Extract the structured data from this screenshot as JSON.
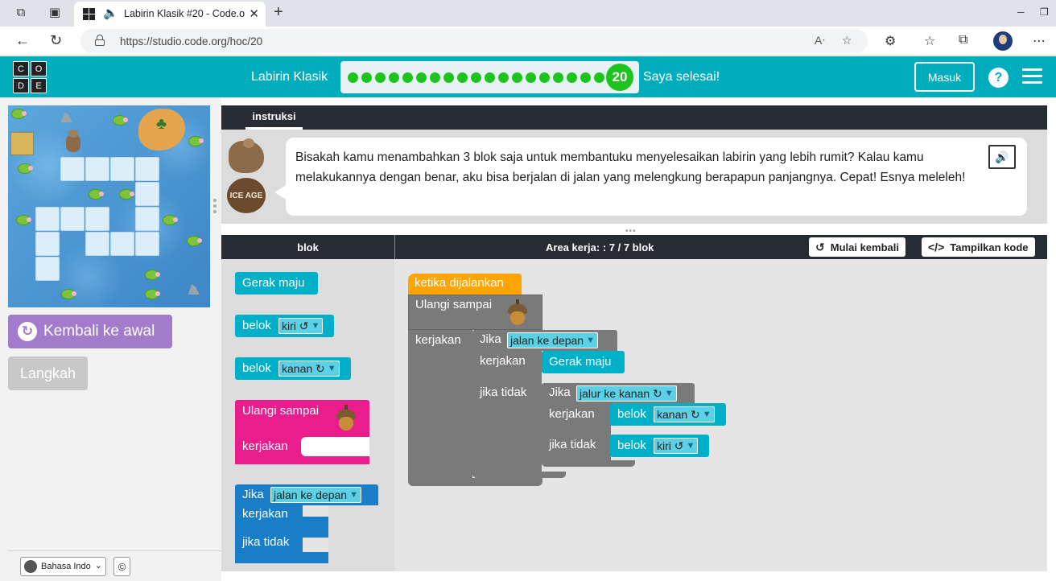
{
  "browser": {
    "tab_title": "Labirin Klasik #20 - Code.org",
    "url": "https://studio.code.org/hoc/20"
  },
  "header": {
    "logo_letters": [
      "C",
      "O",
      "D",
      "E"
    ],
    "level_name": "Labirin Klasik",
    "current_level": "20",
    "total_dots": 19,
    "finished_label": "Saya selesai!",
    "signin_label": "Masuk",
    "help_label": "?"
  },
  "colors": {
    "header": "#00adbc",
    "progress_done": "#1ec41e",
    "reset_button": "#a27bcc",
    "event_block": "#ffa400",
    "loop_block_gray": "#7a7a7a",
    "loop_block_pink": "#e91e8c",
    "action_block": "#00b0c8",
    "if_block_blue": "#1a7dc8"
  },
  "left": {
    "reset_label": "Kembali ke awal",
    "step_label": "Langkah",
    "language": "Bahasa Indo",
    "copyright": "©"
  },
  "instructions": {
    "tab_label": "instruksi",
    "text": "Bisakah kamu menambahkan 3 blok saja untuk membantuku menyelesaikan labirin yang lebih rumit? Kalau kamu melakukannya dengan benar, aku bisa berjalan di jalan yang melengkung berapapun panjangnya. Cepat! Esnya meleleh!",
    "avatar_logo": "ICE AGE"
  },
  "workspace_header": {
    "toolbox_title": "blok",
    "count_label": "Area kerja: : 7 / 7 blok",
    "restart_label": "Mulai kembali",
    "show_code_label": "Tampilkan kode"
  },
  "toolbox": {
    "move_forward": "Gerak maju",
    "turn_left": "belok",
    "turn_left_value": "kiri ↺",
    "turn_right": "belok",
    "turn_right_value": "kanan ↻",
    "repeat_until": "Ulangi sampai",
    "repeat_do": "kerjakan",
    "if_label": "Jika",
    "if_value": "jalan ke depan",
    "if_do": "kerjakan",
    "if_else": "jika tidak"
  },
  "program": {
    "when_run": "ketika dijalankan",
    "repeat_until": "Ulangi sampai",
    "repeat_do": "kerjakan",
    "if1_label": "Jika",
    "if1_value": "jalan ke depan",
    "if1_do": "kerjakan",
    "if1_action": "Gerak maju",
    "if1_else": "jika tidak",
    "if2_label": "Jika",
    "if2_value": "jalur ke kanan ↻",
    "if2_do": "kerjakan",
    "if2_action": "belok",
    "if2_action_value": "kanan ↻",
    "if2_else": "jika tidak",
    "if2_else_action": "belok",
    "if2_else_action_value": "kiri ↺"
  }
}
